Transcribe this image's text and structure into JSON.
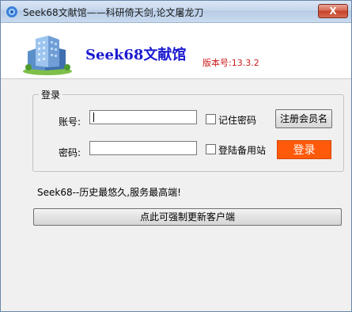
{
  "window": {
    "title": "Seek68文献馆——科研倚天剑,论文屠龙刀",
    "close_label": "X"
  },
  "header": {
    "brand": "Seek68文献馆",
    "version": "版本号:13.3.2"
  },
  "login": {
    "group_label": "登录",
    "account_label": "账号:",
    "account_value": "",
    "password_label": "密码:",
    "password_value": "",
    "remember_label": "记住密码",
    "remember_checked": false,
    "backup_label": "登陆备用站",
    "backup_checked": false,
    "register_label": "注册会员名",
    "login_label": "登录"
  },
  "footer": {
    "slogan": "Seek68--历史最悠久,服务最高端!",
    "update_label": "点此可强制更新客户端"
  },
  "colors": {
    "login_button": "#ff5a0a",
    "brand_text": "#1a1ad0",
    "version_text": "#cc1a1a"
  },
  "icons": [
    "app-icon",
    "building-logo-icon"
  ]
}
